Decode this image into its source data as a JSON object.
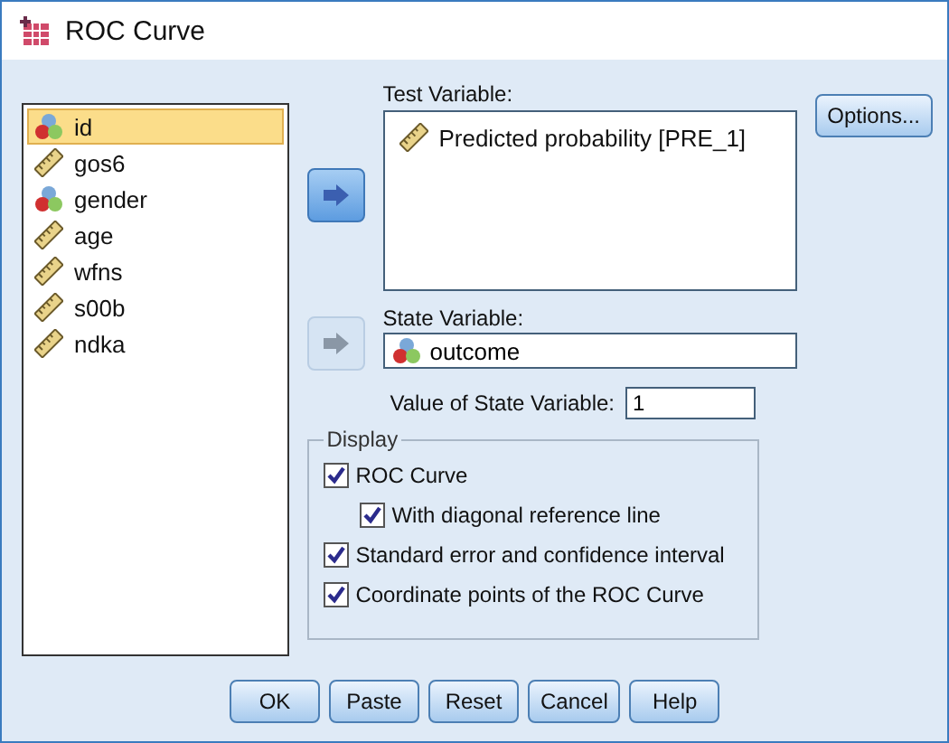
{
  "window": {
    "title": "ROC Curve"
  },
  "variables": [
    {
      "name": "id",
      "kind": "nominal",
      "selected": true
    },
    {
      "name": "gos6",
      "kind": "scale",
      "selected": false
    },
    {
      "name": "gender",
      "kind": "nominal",
      "selected": false
    },
    {
      "name": "age",
      "kind": "scale",
      "selected": false
    },
    {
      "name": "wfns",
      "kind": "scale",
      "selected": false
    },
    {
      "name": "s00b",
      "kind": "scale",
      "selected": false
    },
    {
      "name": "ndka",
      "kind": "scale",
      "selected": false
    }
  ],
  "test_variable": {
    "label": "Test Variable:",
    "items": [
      {
        "name": "Predicted probability [PRE_1]",
        "kind": "scale"
      }
    ],
    "arrow_disabled": false
  },
  "state_variable": {
    "label": "State Variable:",
    "value": "outcome",
    "kind": "nominal",
    "arrow_disabled": true
  },
  "state_value": {
    "label": "Value of State Variable:",
    "value": "1"
  },
  "options_button": "Options...",
  "display": {
    "title": "Display",
    "options": [
      {
        "label": "ROC Curve",
        "checked": true,
        "children": [
          {
            "label": "With diagonal reference line",
            "checked": true
          }
        ]
      },
      {
        "label": "Standard error and confidence interval",
        "checked": true
      },
      {
        "label": "Coordinate points of the ROC Curve",
        "checked": true
      }
    ]
  },
  "buttons": [
    "OK",
    "Paste",
    "Reset",
    "Cancel",
    "Help"
  ]
}
